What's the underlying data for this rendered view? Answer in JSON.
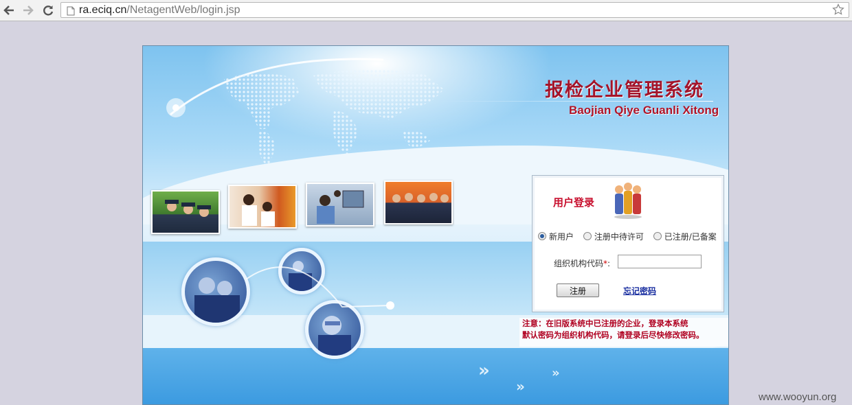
{
  "browser": {
    "url_host": "ra.eciq.cn",
    "url_path": "/NetagentWeb/login.jsp"
  },
  "header": {
    "title_cn": "报检企业管理系统",
    "title_en": "Baojian Qiye Guanli Xitong"
  },
  "login": {
    "title": "用户登录",
    "options": [
      "新用户",
      "注册中待许可",
      "已注册/已备案"
    ],
    "selected_option": "新用户",
    "org_code_label": "组织机构代码",
    "required_mark": "*",
    "colon": ":",
    "org_code_value": "",
    "register_button": "注册",
    "forgot_link": "忘记密码"
  },
  "notice": {
    "line1": "注意：在旧版系统中已注册的企业，登录本系统",
    "line2": "默认密码为组织机构代码，请登录后尽快修改密码。"
  },
  "watermark": "www.wooyun.org",
  "colors": {
    "title_red": "#a3142a",
    "notice_red": "#b00020",
    "link_blue": "#1a2fa0"
  }
}
